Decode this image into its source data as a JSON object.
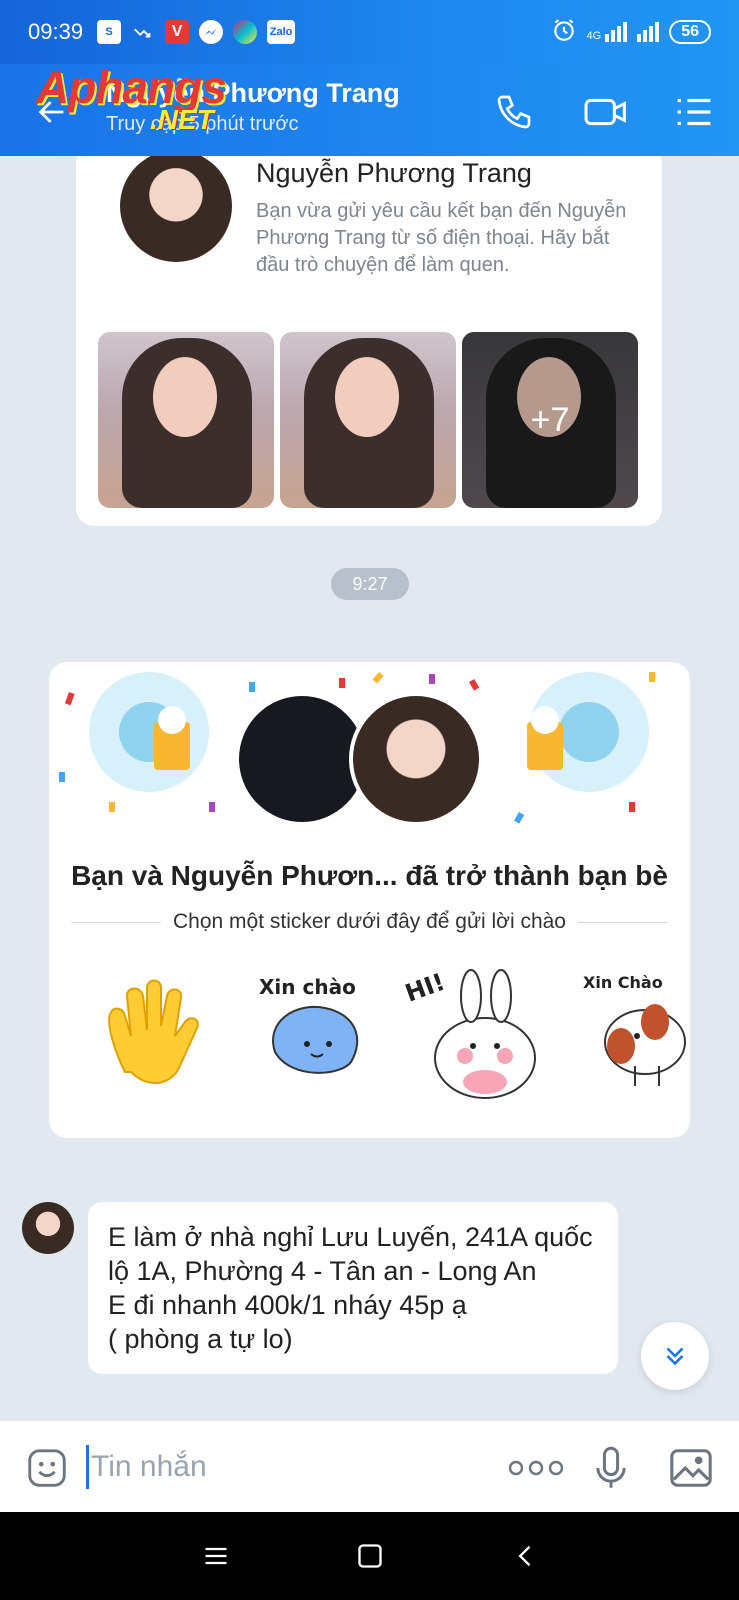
{
  "status_bar": {
    "time": "09:39",
    "network": "4G",
    "battery": "56",
    "app_icons": [
      "sim-icon",
      "missed-call-icon",
      "v-app-icon",
      "messenger-icon",
      "picsart-icon",
      "zalo-icon"
    ],
    "zalo_label": "Zalo",
    "v_label": "V",
    "sim_label": "S"
  },
  "header": {
    "title": "Nguyễn Phương Trang",
    "subtitle": "Truy cập 5 phút trước",
    "watermark_main": "Aphangs",
    "watermark_sub": ".NET"
  },
  "profile_card": {
    "name": "Nguyễn Phương Trang",
    "description": "Bạn vừa gửi yêu cầu kết bạn đến Nguyễn Phương Trang từ số điện thoại. Hãy bắt đầu trò chuyện để làm quen.",
    "more_photos": "+7"
  },
  "timestamp": "9:27",
  "friend_card": {
    "title": "Bạn và Nguyễn Phươn...  đã trở thành bạn bè",
    "subtitle": "Chọn một sticker dưới đây để gửi lời chào",
    "stickers": [
      {
        "name": "wave-hand-sticker",
        "label": ""
      },
      {
        "name": "xin-chao-cat-sticker",
        "label": "Xin chào"
      },
      {
        "name": "hi-bunny-sticker",
        "label": "HI!"
      },
      {
        "name": "xin-chao-dog-sticker",
        "label": "Xin Chào"
      }
    ]
  },
  "message": {
    "lines": [
      "E làm ở nhà nghỉ Lưu Luyến, 241A quốc lộ 1A, Phường 4 - Tân an - Long An",
      "E đi nhanh 400k/1 nháy 45p ạ",
      "( phòng a tự lo)"
    ]
  },
  "composer": {
    "placeholder": "Tin nhắn"
  },
  "colors": {
    "header_blue": "#1a73e8",
    "chat_background": "#e2e8f0",
    "bubble": "#ffffff"
  }
}
